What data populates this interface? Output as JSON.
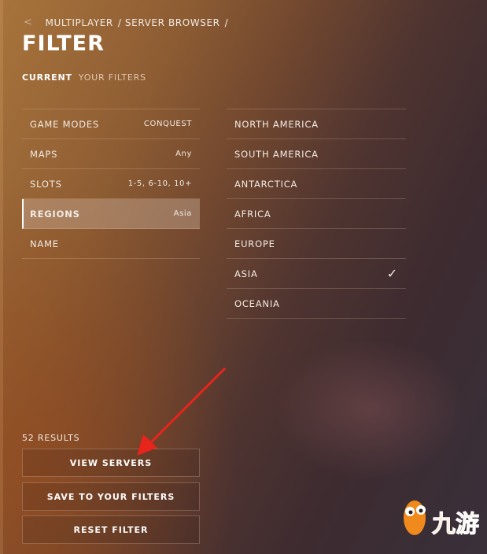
{
  "breadcrumb": {
    "back_icon": "chevron-left-icon",
    "items": [
      "MULTIPLAYER",
      "/ SERVER BROWSER",
      "/"
    ]
  },
  "title": "FILTER",
  "tabs": [
    {
      "label": "CURRENT",
      "active": true
    },
    {
      "label": "YOUR FILTERS",
      "active": false
    }
  ],
  "filters": [
    {
      "label": "GAME MODES",
      "value": "CONQUEST"
    },
    {
      "label": "MAPS",
      "value": "Any"
    },
    {
      "label": "SLOTS",
      "value": "1-5, 6-10, 10+"
    },
    {
      "label": "REGIONS",
      "value": "Asia",
      "selected": true
    },
    {
      "label": "NAME",
      "value": ""
    }
  ],
  "regions": [
    {
      "label": "NORTH AMERICA",
      "checked": false
    },
    {
      "label": "SOUTH AMERICA",
      "checked": false
    },
    {
      "label": "ANTARCTICA",
      "checked": false
    },
    {
      "label": "AFRICA",
      "checked": false
    },
    {
      "label": "EUROPE",
      "checked": false
    },
    {
      "label": "ASIA",
      "checked": true,
      "check": "✓"
    },
    {
      "label": "OCEANIA",
      "checked": false
    }
  ],
  "results": "52 RESULTS",
  "buttons": {
    "view": "VIEW SERVERS",
    "save": "SAVE TO YOUR FILTERS",
    "reset": "RESET FILTER"
  },
  "watermark": {
    "text": "九游"
  },
  "colors": {
    "annotation_arrow": "#e8241c"
  }
}
